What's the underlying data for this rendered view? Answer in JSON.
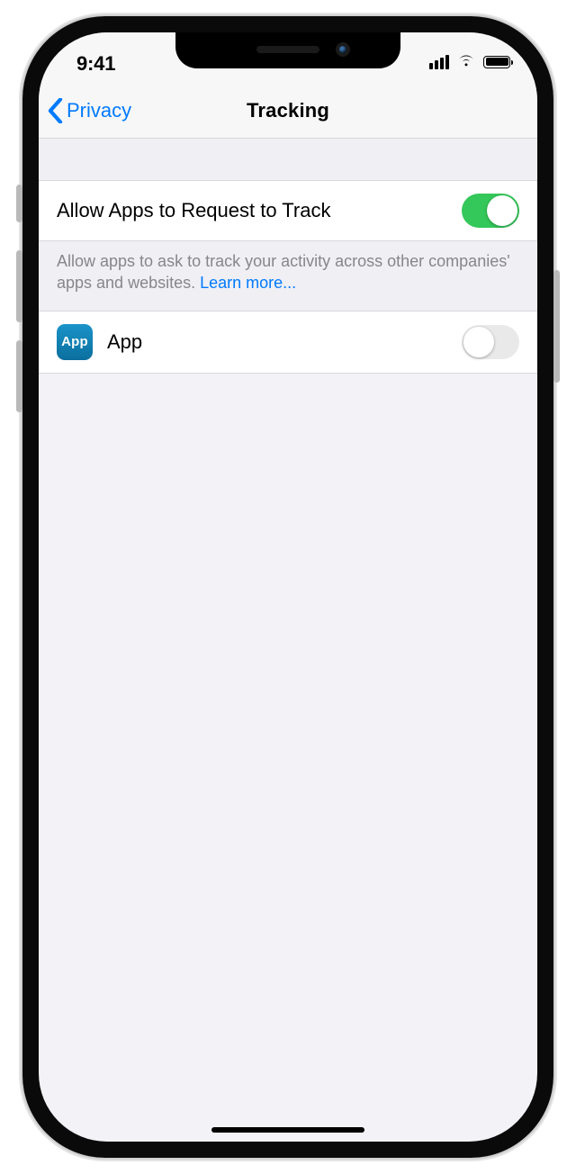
{
  "status": {
    "time": "9:41"
  },
  "nav": {
    "back_label": "Privacy",
    "title": "Tracking"
  },
  "section1": {
    "row_label": "Allow Apps to Request to Track",
    "toggle_on": true,
    "footer_text": "Allow apps to ask to track your activity across other companies' apps and websites. ",
    "learn_more": "Learn more..."
  },
  "apps": [
    {
      "icon_text": "App",
      "name": "App",
      "toggle_on": false
    }
  ]
}
